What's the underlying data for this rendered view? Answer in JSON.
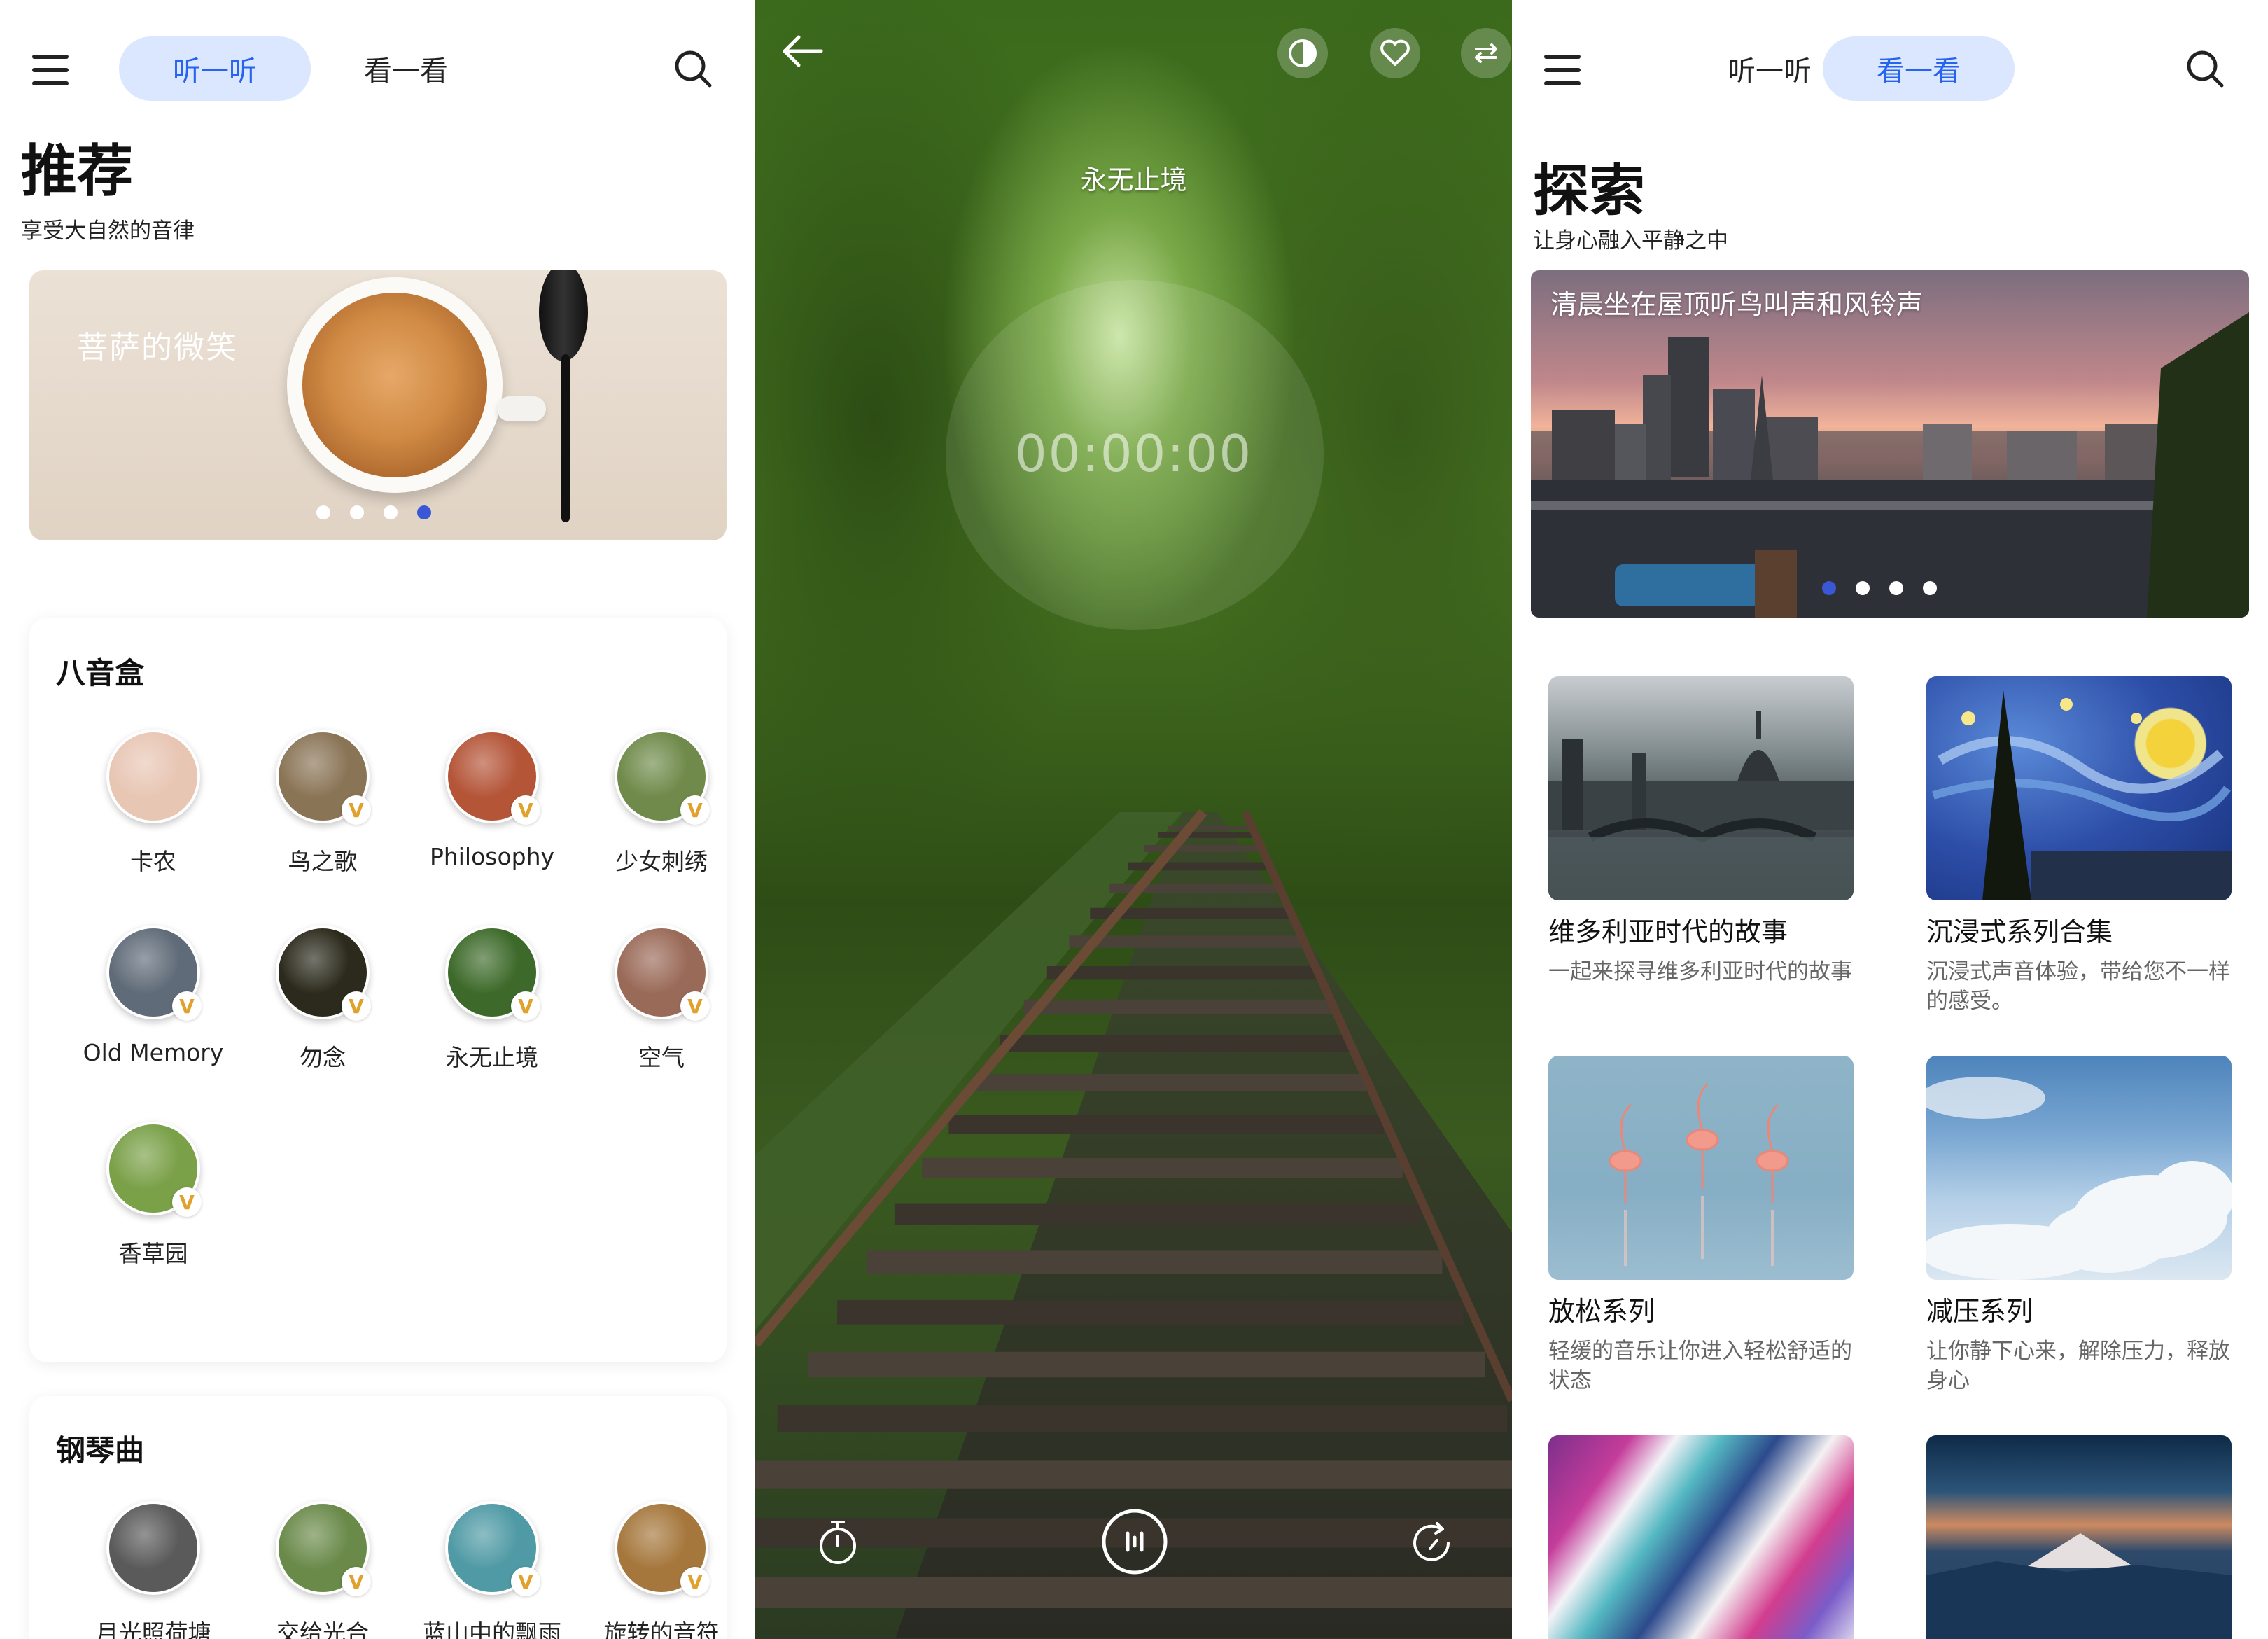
{
  "panel1": {
    "tabs": {
      "listen": "听一听",
      "look": "看一看"
    },
    "title": "推荐",
    "subtitle": "享受大自然的音律",
    "banner": {
      "text": "菩萨的微笑",
      "dots": 4,
      "active_dot": 3
    },
    "music_box": {
      "title": "八音盒",
      "items": [
        {
          "label": "卡农",
          "vip": false,
          "color": "#e8c6b4"
        },
        {
          "label": "鸟之歌",
          "vip": true,
          "color": "#8a7456"
        },
        {
          "label": "Philosophy",
          "vip": true,
          "color": "#b45538"
        },
        {
          "label": "少女刺绣",
          "vip": true,
          "color": "#6f8a4a"
        },
        {
          "label": "Old Memory",
          "vip": true,
          "color": "#5f6b78"
        },
        {
          "label": "勿念",
          "vip": true,
          "color": "#2b2a1c"
        },
        {
          "label": "永无止境",
          "vip": true,
          "color": "#3d6a2a"
        },
        {
          "label": "空气",
          "vip": true,
          "color": "#9a6a58"
        },
        {
          "label": "香草园",
          "vip": true,
          "color": "#7aa048"
        }
      ]
    },
    "piano": {
      "title": "钢琴曲",
      "items": [
        {
          "label": "月光照荷塘",
          "vip": false,
          "color": "#5a5a5a"
        },
        {
          "label": "交给光合",
          "vip": true,
          "color": "#6a8a4a"
        },
        {
          "label": "蓝山中的飘雨",
          "vip": true,
          "color": "#4f9aa5"
        },
        {
          "label": "旋转的音符",
          "vip": true,
          "color": "#a5773c"
        }
      ]
    }
  },
  "panel2": {
    "song_title": "永无止境",
    "timer": "00:00:00",
    "icons": [
      "back-arrow-icon",
      "contrast-icon",
      "heart-icon",
      "shuffle-icon",
      "timer-icon",
      "pause-icon",
      "repeat-icon"
    ]
  },
  "panel3": {
    "tabs": {
      "listen": "听一听",
      "look": "看一看"
    },
    "title": "探索",
    "subtitle": "让身心融入平静之中",
    "banner": {
      "text": "清晨坐在屋顶听鸟叫声和风铃声",
      "dots": 4,
      "active_dot": 0
    },
    "tiles": [
      {
        "title": "维多利亚时代的故事",
        "desc": "一起来探寻维多利亚时代的故事"
      },
      {
        "title": "沉浸式系列合集",
        "desc": "沉浸式声音体验，带给您不一样的感受。"
      },
      {
        "title": "放松系列",
        "desc": "轻缓的音乐让你进入轻松舒适的状态"
      },
      {
        "title": "减压系列",
        "desc": "让你静下心来，解除压力，释放身心"
      },
      {
        "title": "",
        "desc": ""
      },
      {
        "title": "",
        "desc": ""
      }
    ]
  },
  "colors": {
    "accent": "#2563f0",
    "segment_bg": "#dbe6ff",
    "vip_gold": "#e0a22c",
    "active_dot": "#3a58d6"
  }
}
